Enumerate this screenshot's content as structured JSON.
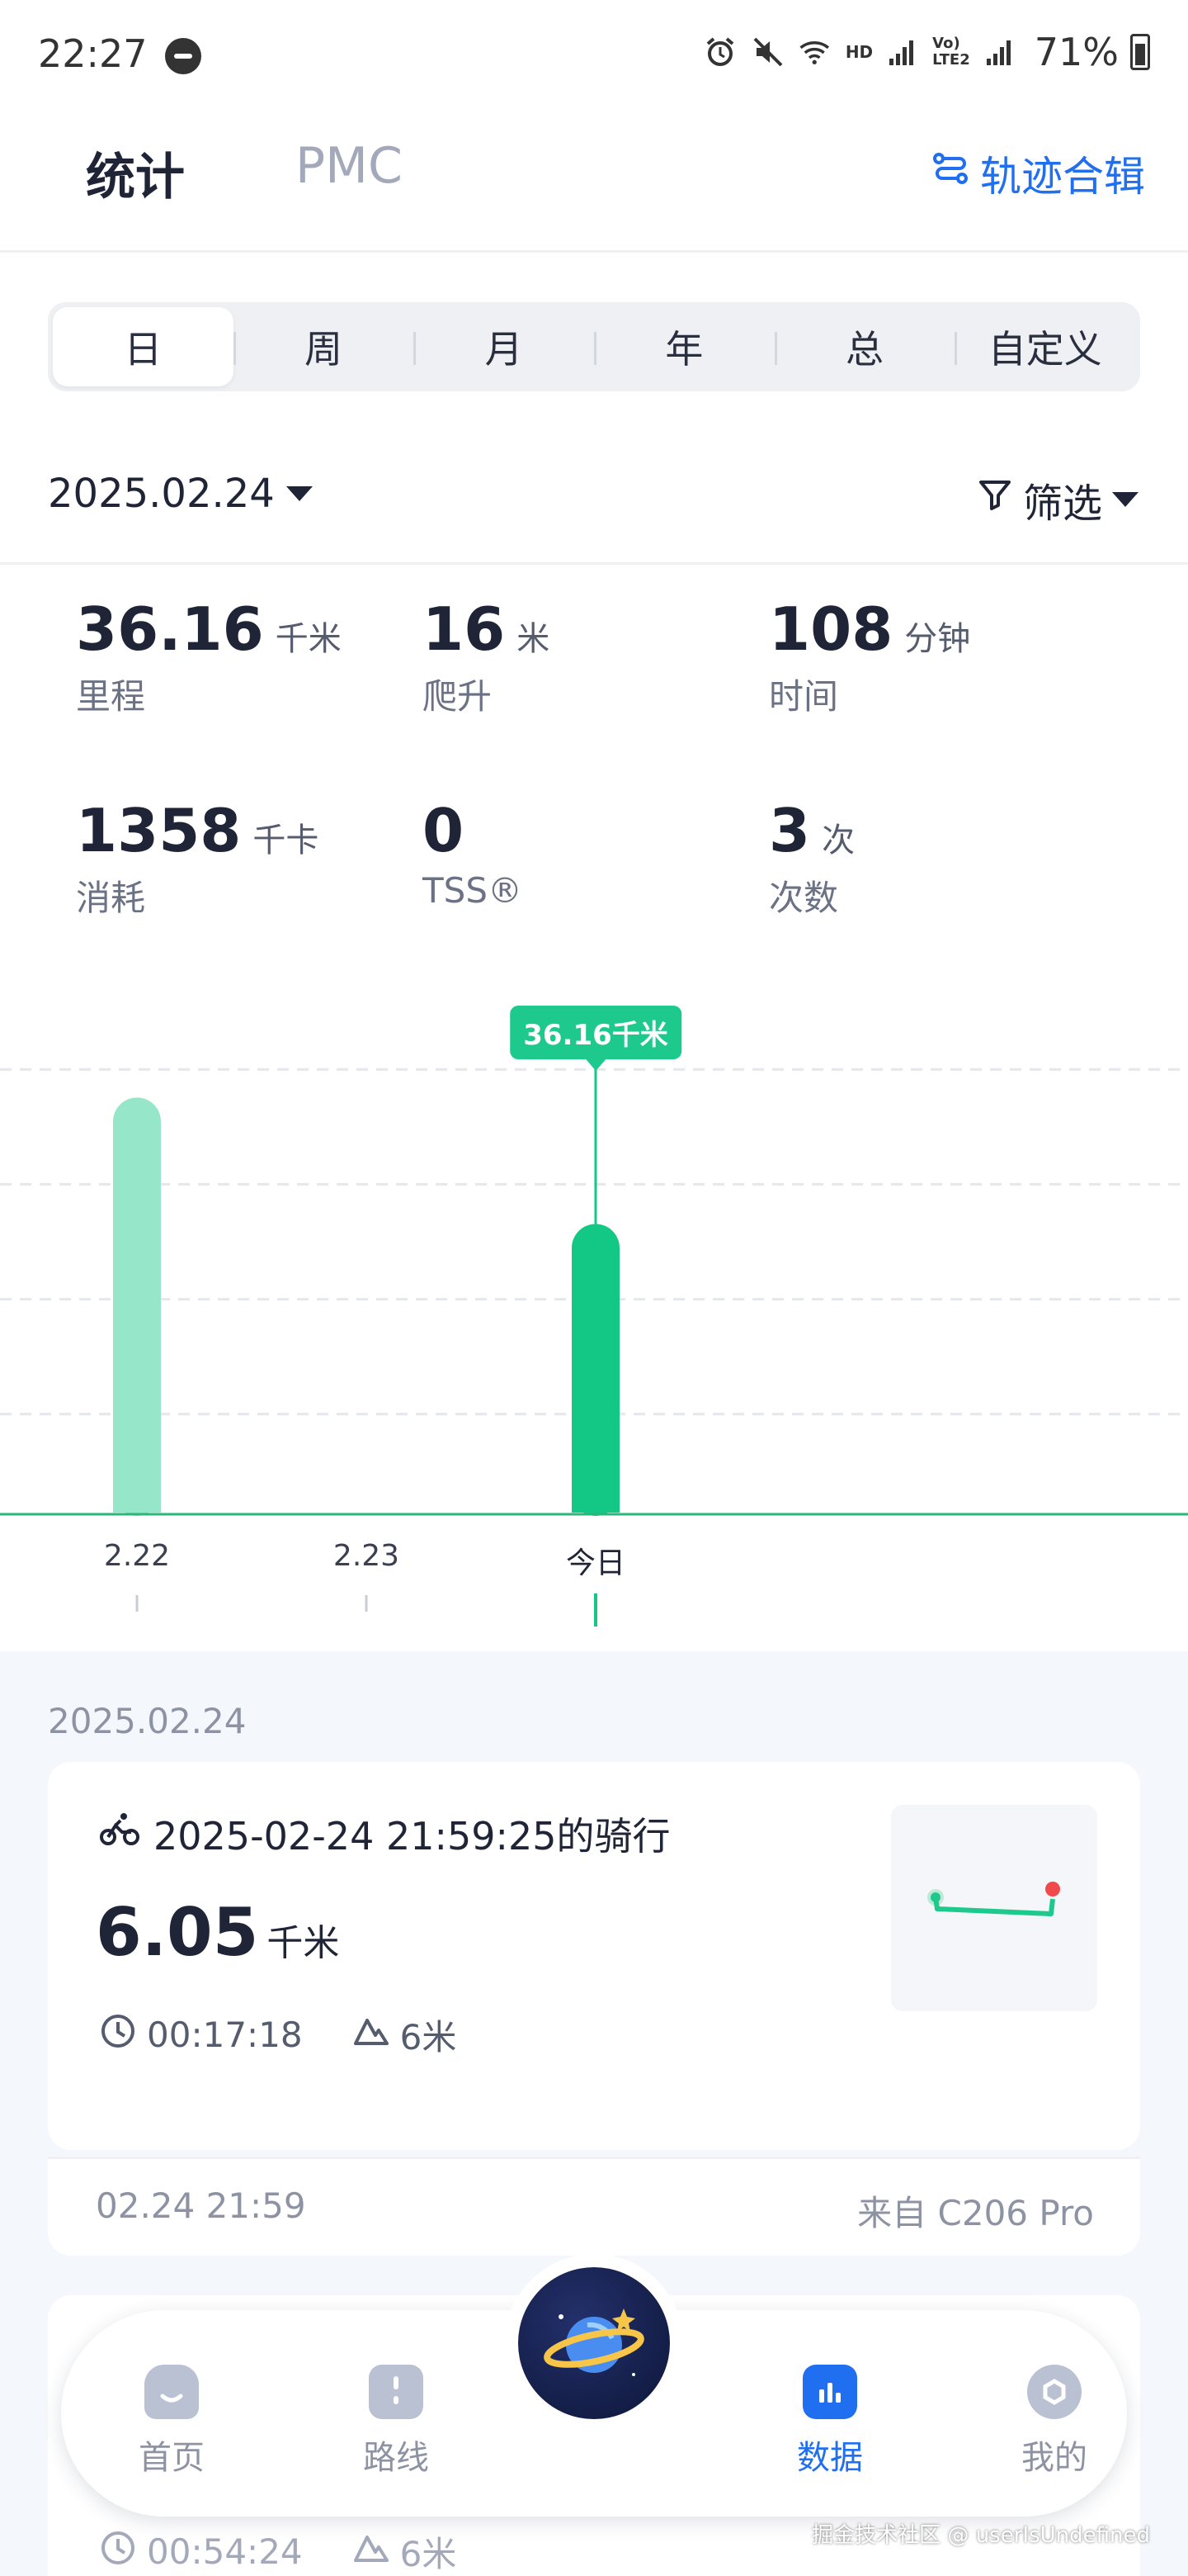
{
  "status_bar": {
    "time": "22:27",
    "net_hd": "HD",
    "volte": "Vo)\nLTE2",
    "battery": "71%"
  },
  "header": {
    "tab_stats": "统计",
    "tab_pmc": "PMC",
    "track_collection": "轨迹合辑"
  },
  "segments": [
    "日",
    "周",
    "月",
    "年",
    "总",
    "自定义"
  ],
  "active_segment": 0,
  "date_selector": "2025.02.24",
  "filter_label": "筛选",
  "stats": [
    {
      "value": "36.16",
      "unit": "千米",
      "label": "里程"
    },
    {
      "value": "16",
      "unit": "米",
      "label": "爬升"
    },
    {
      "value": "108",
      "unit": "分钟",
      "label": "时间"
    },
    {
      "value": "1358",
      "unit": "千卡",
      "label": "消耗"
    },
    {
      "value": "0",
      "unit": "",
      "label": "TSS®"
    },
    {
      "value": "3",
      "unit": "次",
      "label": "次数"
    }
  ],
  "chart_data": {
    "type": "bar",
    "categories": [
      "2.22",
      "2.23",
      "今日"
    ],
    "values": [
      52,
      0,
      36.16
    ],
    "ylim": [
      0,
      60
    ],
    "highlight_index": 2,
    "tooltip": "36.16千米",
    "grid": true,
    "colors": {
      "bar": "#96e6c9",
      "bar_active": "#12c884",
      "axis": "#2ab67b"
    }
  },
  "list": {
    "group_date": "2025.02.24",
    "activities": [
      {
        "title": "2025-02-24 21:59:25的骑行",
        "distance": "6.05",
        "distance_unit": "千米",
        "duration": "00:17:18",
        "elevation": "6米",
        "time": "02.24 21:59",
        "source": "来自 C206 Pro"
      },
      {
        "duration": "00:54:24",
        "elevation": "6米"
      }
    ]
  },
  "nav": [
    {
      "label": "首页",
      "icon": "home-icon"
    },
    {
      "label": "路线",
      "icon": "route-icon"
    },
    {
      "label": "数据",
      "icon": "data-icon",
      "active": true
    },
    {
      "label": "我的",
      "icon": "profile-icon"
    }
  ],
  "watermark": "掘金技术社区 @ userIsUndefined"
}
